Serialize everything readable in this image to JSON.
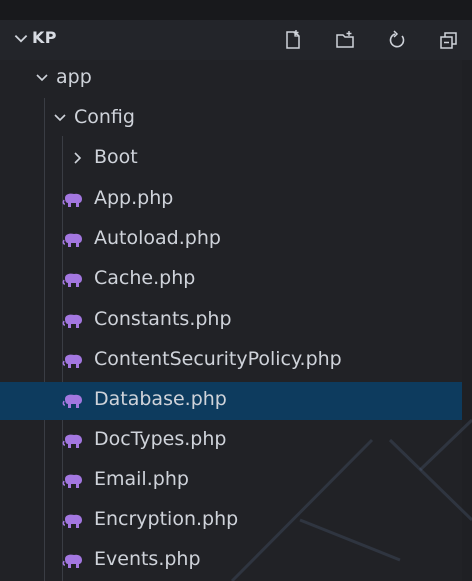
{
  "explorer": {
    "root_label": "KP",
    "actions": [
      {
        "name": "new-file-icon"
      },
      {
        "name": "new-folder-icon"
      },
      {
        "name": "refresh-icon"
      },
      {
        "name": "collapse-all-icon"
      }
    ]
  },
  "tree": {
    "folders": {
      "app": "app",
      "config": "Config",
      "boot": "Boot"
    },
    "files": [
      {
        "label": "App.php",
        "icon": "php-elephant-icon"
      },
      {
        "label": "Autoload.php",
        "icon": "php-elephant-icon"
      },
      {
        "label": "Cache.php",
        "icon": "php-elephant-icon"
      },
      {
        "label": "Constants.php",
        "icon": "php-elephant-icon"
      },
      {
        "label": "ContentSecurityPolicy.php",
        "icon": "php-elephant-icon"
      },
      {
        "label": "Database.php",
        "icon": "php-elephant-icon",
        "selected": true
      },
      {
        "label": "DocTypes.php",
        "icon": "php-elephant-icon"
      },
      {
        "label": "Email.php",
        "icon": "php-elephant-icon"
      },
      {
        "label": "Encryption.php",
        "icon": "php-elephant-icon"
      },
      {
        "label": "Events.php",
        "icon": "php-elephant-icon"
      }
    ]
  },
  "colors": {
    "php_icon": "#a377e0",
    "selection": "#0d3b5e",
    "text": "#cfd3da"
  }
}
